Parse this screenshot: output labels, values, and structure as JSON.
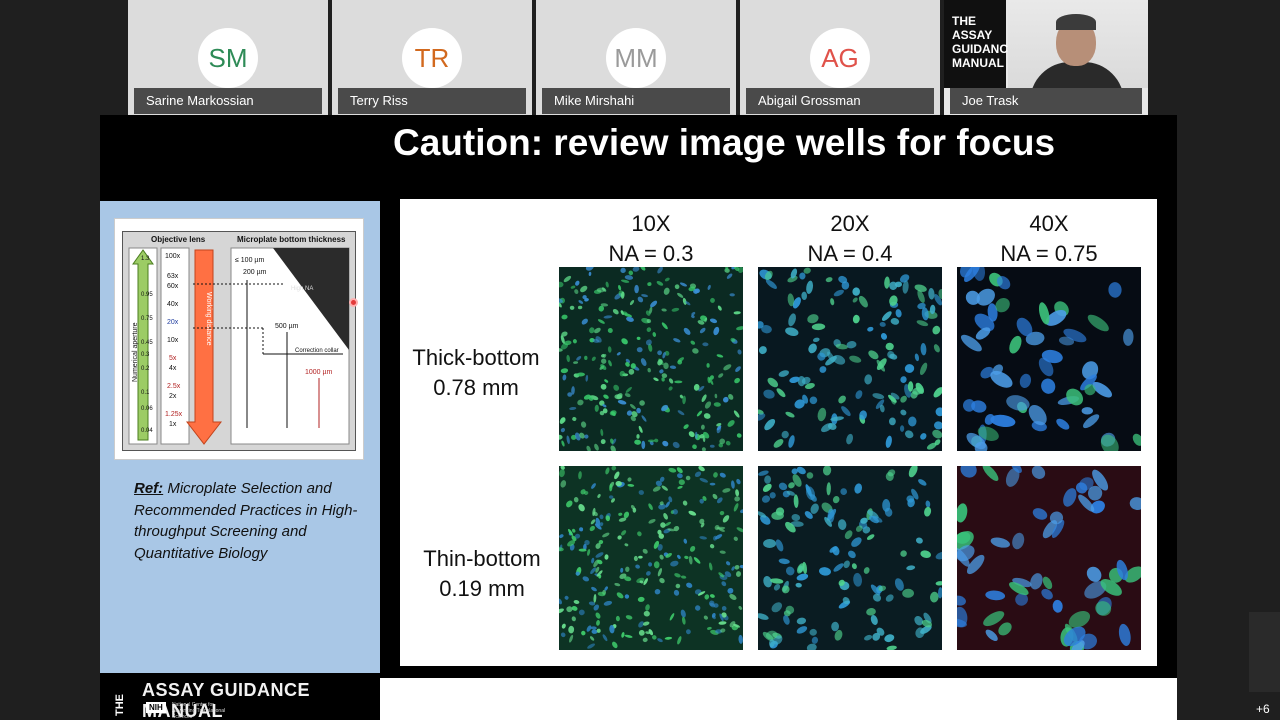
{
  "participants": [
    {
      "initials": "SM",
      "name": "Sarine Markossian",
      "color": "#2e8b57"
    },
    {
      "initials": "TR",
      "name": "Terry Riss",
      "color": "#d2691e"
    },
    {
      "initials": "MM",
      "name": "Mike Mirshahi",
      "color": "#9a9a9a"
    },
    {
      "initials": "AG",
      "name": "Abigail Grossman",
      "color": "#e0524a"
    }
  ],
  "presenter": {
    "name": "Joe Trask",
    "logo_lines": [
      "THE",
      "ASSAY",
      "GUIDANCE",
      "MANUAL"
    ]
  },
  "slide": {
    "title": "Caution: review image wells for focus",
    "ref_label": "Ref:",
    "ref_text": " Microplate Selection and Recommended Practices in High-throughput Screening and Quantitative Biology",
    "columns": [
      {
        "mag": "10X",
        "na": "NA = 0.3"
      },
      {
        "mag": "20X",
        "na": "NA = 0.4"
      },
      {
        "mag": "40X",
        "na": "NA = 0.75"
      }
    ],
    "rows": [
      {
        "name": "Thick-bottom",
        "thickness": "0.78 mm"
      },
      {
        "name": "Thin-bottom",
        "thickness": "0.19 mm"
      }
    ],
    "diagram": {
      "objective_header": "Objective lens",
      "plate_header": "Microplate bottom thickness",
      "na_axis": "Numerical aperture",
      "wd_axis": "Working distance",
      "na_values": [
        "1.3",
        "0.95",
        "0.75",
        "0.45",
        "0.3",
        "0.2",
        "0.1",
        "0.06",
        "0.04"
      ],
      "mags": [
        "100x",
        "63x",
        "60x",
        "40x",
        "20x",
        "10x",
        "5x",
        "4x",
        "2.5x",
        "2x",
        "1.25x",
        "1x"
      ],
      "thickness_labels": [
        "≤ 100 µm",
        "200 µm",
        "500 µm",
        "1000 µm"
      ],
      "high_na": "High NA",
      "collar": "Correction collar"
    },
    "footer_brand": "ASSAY GUIDANCE MANUAL",
    "footer_the": "THE",
    "footer_nih": "NIH",
    "footer_nih_sub": "National Center for Advancing Translational Sciences"
  },
  "overflow_count": "+6"
}
